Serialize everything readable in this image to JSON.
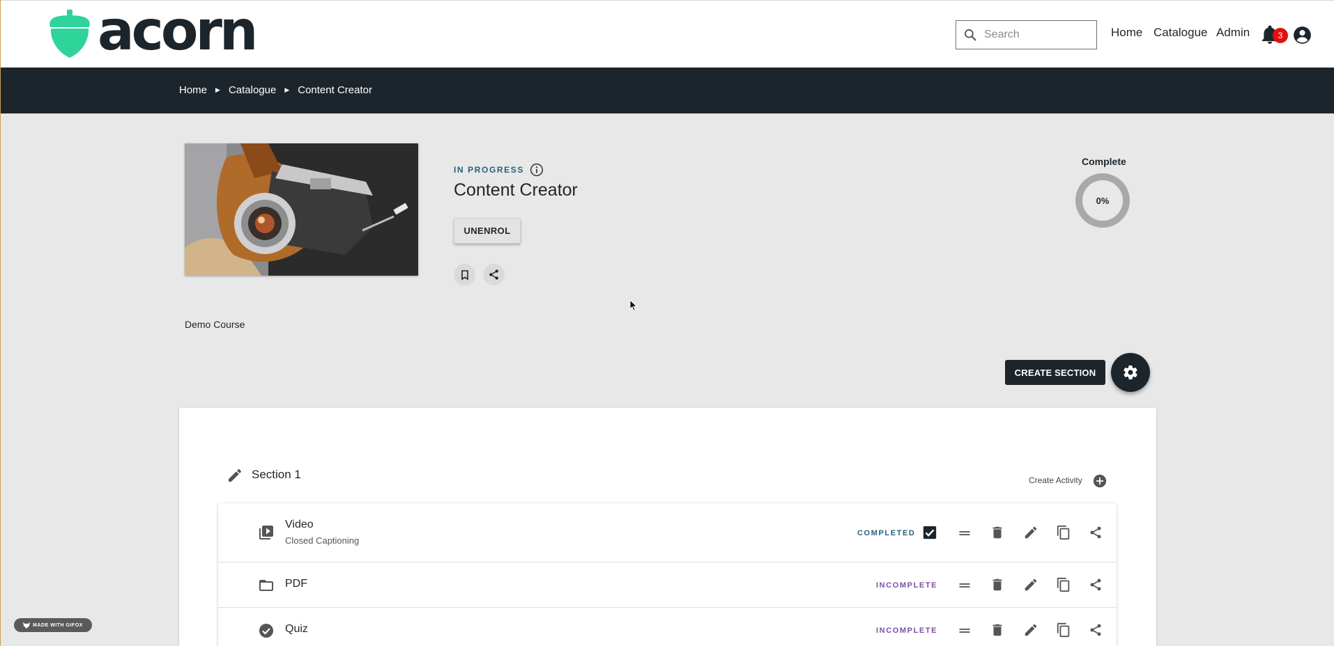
{
  "header": {
    "logo_text": "acorn",
    "search_placeholder": "Search",
    "nav": [
      "Home",
      "Catalogue",
      "Admin"
    ],
    "notification_count": "3"
  },
  "breadcrumb": [
    "Home",
    "Catalogue",
    "Content Creator"
  ],
  "course": {
    "status": "IN PROGRESS",
    "title": "Content Creator",
    "unenrol_label": "UNENROL",
    "complete_label": "Complete",
    "progress_percent": 0,
    "progress_text": "0%",
    "type_label": "Demo Course"
  },
  "actions": {
    "create_section_label": "CREATE SECTION"
  },
  "section": {
    "title": "Section 1",
    "create_activity_label": "Create Activity",
    "activities": [
      {
        "name": "Video",
        "subtitle": "Closed Captioning",
        "status": "COMPLETED",
        "checked": true,
        "icon": "video-library-icon"
      },
      {
        "name": "PDF",
        "subtitle": "",
        "status": "INCOMPLETE",
        "checked": false,
        "icon": "folder-open-icon"
      },
      {
        "name": "Quiz",
        "subtitle": "",
        "status": "INCOMPLETE",
        "checked": false,
        "icon": "check-circle-icon"
      }
    ]
  },
  "watermark": "MADE WITH GIFOX",
  "colors": {
    "brand_green": "#2fd49b",
    "dark": "#1d252c",
    "completed": "#2a5f7a",
    "incomplete": "#7b4fa3",
    "badge": "#e01010"
  }
}
